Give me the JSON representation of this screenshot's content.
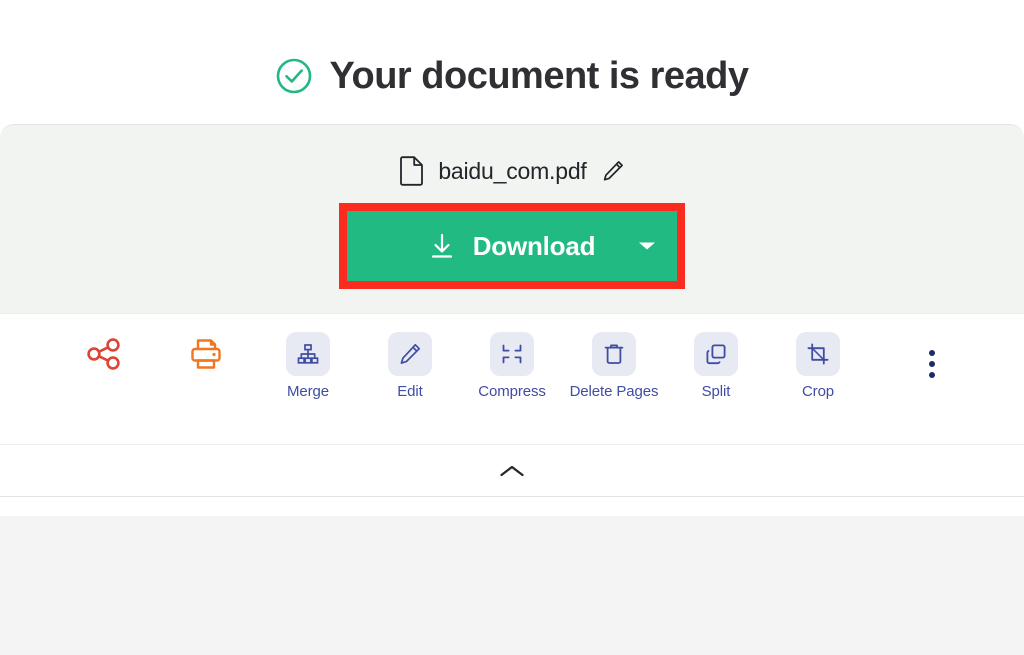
{
  "heading": {
    "text": "Your document is ready",
    "icon": "check-circle-icon",
    "icon_color": "#22b880"
  },
  "file": {
    "name": "baidu_com.pdf",
    "doc_icon": "document-icon",
    "edit_icon": "pencil-icon"
  },
  "download": {
    "label": "Download",
    "icon": "download-arrow-icon",
    "caret": "chevron-down-icon",
    "bg_color": "#21ba82",
    "highlight_color": "#fb2b20"
  },
  "tools": [
    {
      "name": "share",
      "label": "",
      "icon": "share-icon",
      "color": "#dd4535",
      "tile": false
    },
    {
      "name": "print",
      "label": "",
      "icon": "printer-icon",
      "color": "#f07621",
      "tile": false
    },
    {
      "name": "merge",
      "label": "Merge",
      "icon": "merge-icon",
      "color": "#3f4da3",
      "tile": true
    },
    {
      "name": "edit",
      "label": "Edit",
      "icon": "edit-pencil-icon",
      "color": "#3f4da3",
      "tile": true
    },
    {
      "name": "compress",
      "label": "Compress",
      "icon": "compress-icon",
      "color": "#3f4da3",
      "tile": true
    },
    {
      "name": "delete-pages",
      "label": "Delete Pages",
      "icon": "trash-icon",
      "color": "#3f4da3",
      "tile": true
    },
    {
      "name": "split",
      "label": "Split",
      "icon": "split-icon",
      "color": "#3f4da3",
      "tile": true
    },
    {
      "name": "crop",
      "label": "Crop",
      "icon": "crop-icon",
      "color": "#3f4da3",
      "tile": true
    }
  ],
  "more_menu": {
    "icon": "more-vertical-icon",
    "label": ""
  },
  "collapse": {
    "icon": "chevron-up-icon",
    "label": ""
  }
}
